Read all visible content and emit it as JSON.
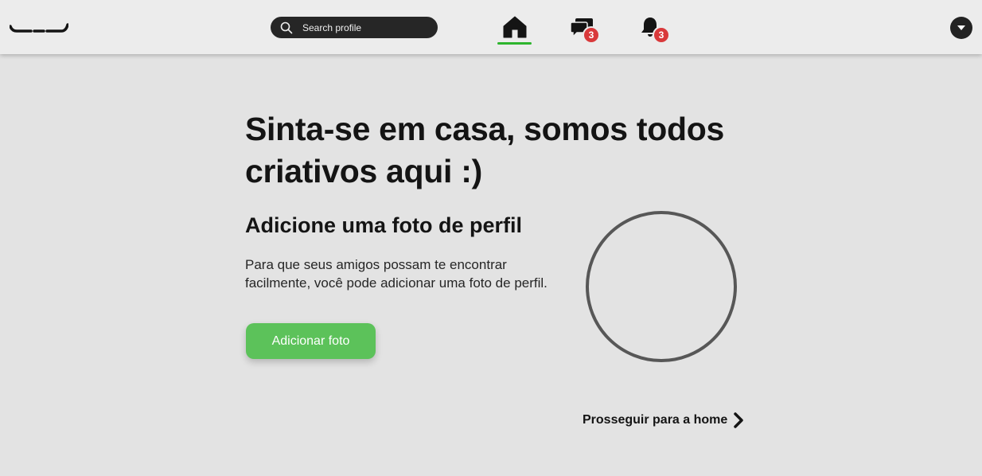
{
  "header": {
    "search": {
      "placeholder": "Search profile",
      "icon": "search-icon"
    },
    "nav": {
      "home": {
        "icon": "home-icon",
        "active": true,
        "active_color": "#2eb52e"
      },
      "messages": {
        "icon": "chat-icon",
        "badge": "3"
      },
      "notifications": {
        "icon": "bell-icon",
        "badge": "3"
      }
    },
    "profile_menu": {
      "icon": "chevron-down-icon"
    }
  },
  "main": {
    "headline": "Sinta-se em casa, somos todos criativos aqui :)",
    "subheading": "Adicione uma foto de perfil",
    "description": "Para que seus amigos possam te encontrar facilmente, você pode adicionar uma foto de perfil.",
    "add_photo_label": "Adicionar foto",
    "proceed_label": "Prosseguir para a home"
  },
  "colors": {
    "background": "#e3e3e3",
    "header": "#ececec",
    "accent_green": "#5cc25a",
    "badge_red": "#d9393b"
  }
}
